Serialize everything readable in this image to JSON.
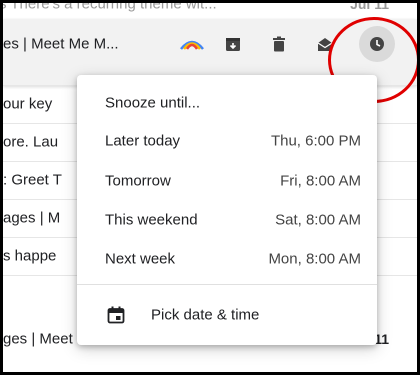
{
  "email_rows": [
    {
      "text": "s There's a recurring theme wit...",
      "date": "Jul 11"
    },
    {
      "text": "es | Meet Me M...",
      "date": ""
    },
    {
      "text": "our key",
      "date": ""
    },
    {
      "text": "ore. Lau",
      "date": ""
    },
    {
      "text": ": Greet T",
      "date": ""
    },
    {
      "text": "ages | M",
      "date": ""
    },
    {
      "text": "s happe",
      "date": ""
    },
    {
      "text": "ges | Meet Me Meet Me Miss liv...",
      "date": "Jul 11"
    }
  ],
  "snooze_menu": {
    "title": "Snooze until...",
    "options": [
      {
        "label": "Later today",
        "time": "Thu, 6:00 PM"
      },
      {
        "label": "Tomorrow",
        "time": "Fri, 8:00 AM"
      },
      {
        "label": "This weekend",
        "time": "Sat, 8:00 AM"
      },
      {
        "label": "Next week",
        "time": "Mon, 8:00 AM"
      }
    ],
    "pick_label": "Pick date & time"
  },
  "colors": {
    "annotation": "#e00000",
    "text": "#202124"
  }
}
